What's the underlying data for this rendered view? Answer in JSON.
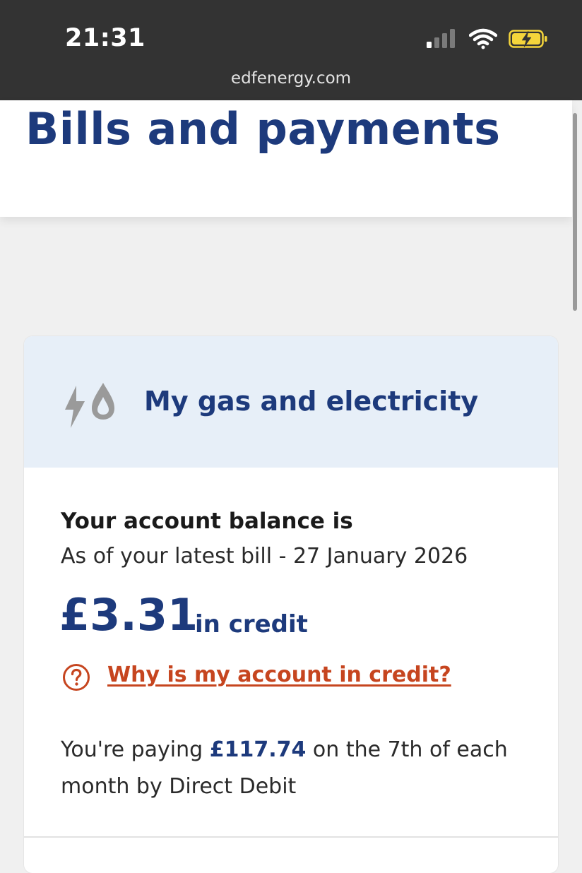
{
  "status_bar": {
    "time": "21:31",
    "url": "edfenergy.com"
  },
  "page": {
    "title": "Bills and payments"
  },
  "card": {
    "title": "My gas and electricity",
    "icon": "gas-electric-icon",
    "balance_heading": "Your account balance is",
    "balance_date": "As of your latest bill - 27 January 2026",
    "balance_amount": "£3.31",
    "balance_status": "in credit",
    "help_link": "Why is my account in credit?",
    "payment_prefix": "You're paying ",
    "payment_amount": "£117.74",
    "payment_suffix": " on the 7th of each month by Direct Debit"
  },
  "colors": {
    "brand_navy": "#1d3a7c",
    "link_orange": "#c6451f",
    "header_tint": "#e7eff8",
    "battery_yellow": "#f5d53b"
  }
}
